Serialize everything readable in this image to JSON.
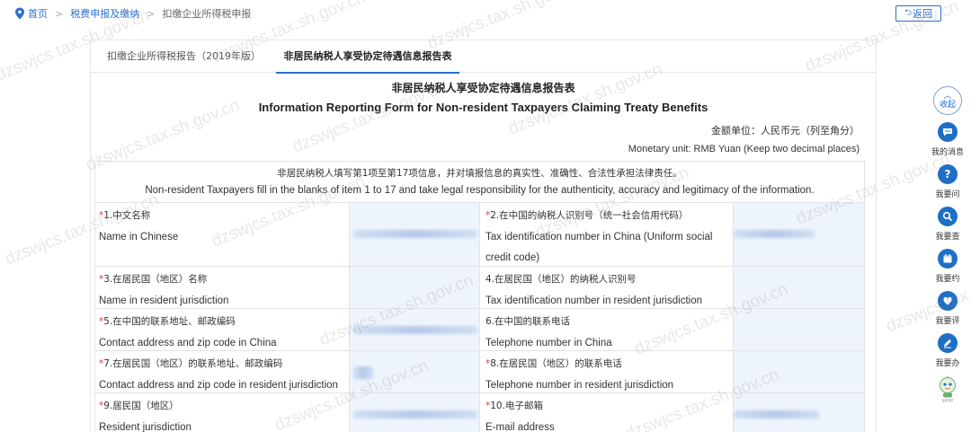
{
  "breadcrumb": {
    "home": "首页",
    "level1": "税费申报及缴纳",
    "level2": "扣缴企业所得税申报"
  },
  "back_button": "返回",
  "tabs": [
    {
      "label": "扣缴企业所得税报告（2019年版）",
      "active": false
    },
    {
      "label": "非居民纳税人享受协定待遇信息报告表",
      "active": true
    }
  ],
  "form": {
    "title_cn": "非居民纳税人享受协定待遇信息报告表",
    "title_en": "Information Reporting Form for Non-resident Taxpayers Claiming Treaty Benefits",
    "unit_cn": "金额单位：人民币元（列至角分）",
    "unit_en": "Monetary unit: RMB Yuan (Keep two decimal places)",
    "note_cn": "非居民纳税人填写第1项至第17项信息，并对填报信息的真实性、准确性、合法性承担法律责任。",
    "note_en": "Non-resident Taxpayers fill in the blanks of item 1 to 17 and take legal responsibility for the authenticity, accuracy and legitimacy of the information.",
    "fields": [
      {
        "cn": "1.中文名称",
        "en": "Name in Chinese",
        "required": true
      },
      {
        "cn": "2.在中国的纳税人识别号（统一社会信用代码）",
        "en": "Tax identification number in China (Uniform social credit code)",
        "required": true
      },
      {
        "cn": "3.在居民国（地区）名称",
        "en": "Name in resident jurisdiction",
        "required": true
      },
      {
        "cn": "4.在居民国（地区）的纳税人识别号",
        "en": "Tax identification number in resident jurisdiction",
        "required": false
      },
      {
        "cn": "5.在中国的联系地址、邮政编码",
        "en": "Contact address and zip code in China",
        "required": true
      },
      {
        "cn": "6.在中国的联系电话",
        "en": "Telephone number in China",
        "required": false
      },
      {
        "cn": "7.在居民国（地区）的联系地址、邮政编码",
        "en": "Contact address and zip code in resident jurisdiction",
        "required": true
      },
      {
        "cn": "8.在居民国（地区）的联系电话",
        "en": "Telephone number in resident jurisdiction",
        "required": true
      },
      {
        "cn": "9.居民国（地区）",
        "en": "Resident jurisdiction",
        "required": true
      },
      {
        "cn": "10.电子邮箱",
        "en": "E-mail address",
        "required": true
      }
    ]
  },
  "float_bar": {
    "collapse": "收起",
    "items": [
      "我的消息",
      "我要问",
      "我要查",
      "我要约",
      "我要评",
      "我要办"
    ],
    "robot_caption": "智能导税"
  },
  "watermark": "dzswjcs.tax.sh.gov.cn",
  "colors": {
    "accent": "#2a6fc9",
    "icon_blue": "#1f6fc5",
    "required": "#e33333",
    "input_bg": "#eef4fc"
  }
}
